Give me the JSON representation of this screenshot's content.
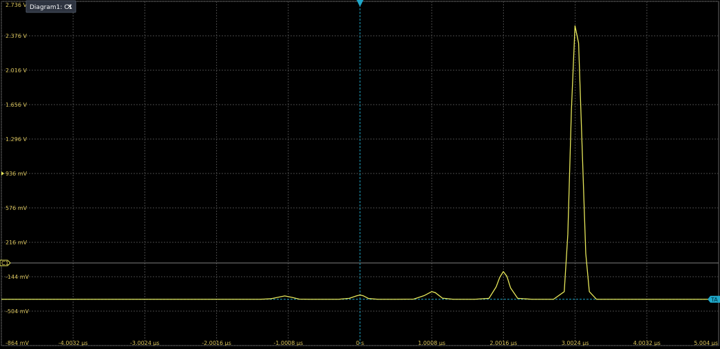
{
  "tab": {
    "label": "Diagram1: C1",
    "close_glyph": "✕"
  },
  "colors": {
    "background": "#000000",
    "grid": "#4a4a4a",
    "trace": "#e8e85a",
    "label": "#d8c25a",
    "cyan": "#1fa7c9",
    "panel": "#2e3440"
  },
  "markers": {
    "channel_label": "C1",
    "trigger_label": "TA",
    "trigger_glyph": "▼"
  },
  "chart_data": {
    "type": "line",
    "title": "",
    "xlabel": "",
    "ylabel": "",
    "xlim": [
      -5.004,
      5.004
    ],
    "ylim": [
      -0.864,
      2.736
    ],
    "grid": true,
    "x_units": "µs",
    "y_units": "V",
    "x_ticks": [
      -4.0032,
      -3.0024,
      -2.0016,
      -1.0008,
      0,
      1.0008,
      2.0016,
      3.0024,
      4.0032,
      5.004
    ],
    "x_tick_labels": [
      "-4.0032 µs",
      "-3.0024 µs",
      "-2.0016 µs",
      "-1.0008 µs",
      "0 s",
      "1.0008 µs",
      "2.0016 µs",
      "3.0024 µs",
      "4.0032 µs",
      "5.004 µs"
    ],
    "y_ticks": [
      2.736,
      2.376,
      2.016,
      1.656,
      1.296,
      0.936,
      0.576,
      0.216,
      -0.144,
      -0.504,
      -0.864
    ],
    "y_tick_labels": [
      "2.736 V",
      "2.376 V",
      "2.016 V",
      "1.656 V",
      "1.296 V",
      "936 mV",
      "576 mV",
      "216 mV",
      "-144 mV",
      "-504 mV",
      "-864 mV"
    ],
    "channel_offset_level": 0.0,
    "trigger_time": 0,
    "trigger_level": -0.38,
    "series": [
      {
        "x": [
          -5.004,
          -4.6,
          -4.2,
          -3.8,
          -3.4,
          -3.0,
          -2.6,
          -2.2,
          -1.8,
          -1.4,
          -1.25,
          -1.15,
          -1.05,
          -0.95,
          -0.85,
          -0.7,
          -0.5,
          -0.3,
          -0.15,
          -0.05,
          0.0,
          0.05,
          0.12,
          0.25,
          0.5,
          0.75,
          0.9,
          1.0,
          1.05,
          1.15,
          1.3,
          1.6,
          1.8,
          1.9,
          1.95,
          2.0,
          2.05,
          2.1,
          2.2,
          2.4,
          2.7,
          2.85,
          2.9,
          2.95,
          3.0,
          3.05,
          3.1,
          3.15,
          3.2,
          3.3,
          3.5,
          3.8,
          4.1,
          4.4,
          4.7,
          5.004
        ],
        "y": [
          -0.38,
          -0.38,
          -0.38,
          -0.38,
          -0.38,
          -0.38,
          -0.38,
          -0.38,
          -0.38,
          -0.38,
          -0.375,
          -0.36,
          -0.345,
          -0.36,
          -0.378,
          -0.38,
          -0.38,
          -0.38,
          -0.37,
          -0.345,
          -0.335,
          -0.345,
          -0.372,
          -0.38,
          -0.38,
          -0.378,
          -0.34,
          -0.3,
          -0.31,
          -0.368,
          -0.38,
          -0.38,
          -0.37,
          -0.25,
          -0.15,
          -0.09,
          -0.14,
          -0.26,
          -0.37,
          -0.38,
          -0.38,
          -0.3,
          0.3,
          1.6,
          2.48,
          2.3,
          1.2,
          0.1,
          -0.3,
          -0.38,
          -0.38,
          -0.38,
          -0.38,
          -0.38,
          -0.38,
          -0.38
        ]
      }
    ]
  }
}
